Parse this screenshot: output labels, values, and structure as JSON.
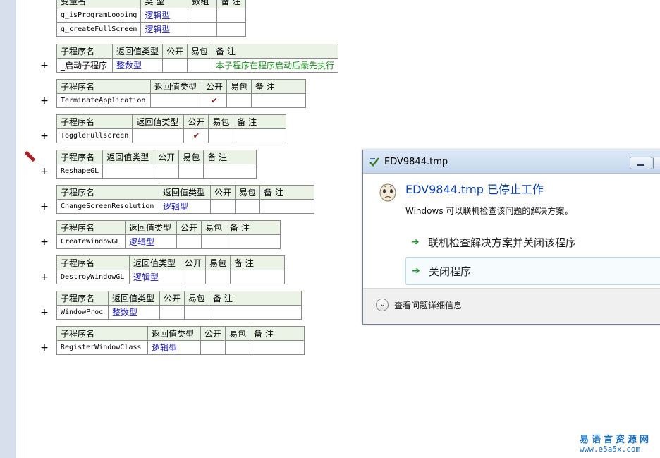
{
  "variables": {
    "headers": [
      "变量名",
      "类 型",
      "数组",
      "备 注"
    ],
    "rows": [
      {
        "name": "g_isProgramLooping",
        "type": "逻辑型"
      },
      {
        "name": "g_createFullScreen",
        "type": "逻辑型"
      }
    ]
  },
  "sub_headers": [
    "子程序名",
    "返回值类型",
    "公开",
    "易包",
    "备 注"
  ],
  "subroutines": [
    {
      "name": "_启动子程序",
      "return_type": "整数型",
      "public": "",
      "note": "本子程序在程序启动后最先执行"
    },
    {
      "name": "TerminateApplication",
      "return_type": "",
      "public": "✔",
      "note": ""
    },
    {
      "name": "ToggleFullscreen",
      "return_type": "",
      "public": "✔",
      "note": ""
    },
    {
      "name": "ReshapeGL",
      "return_type": "",
      "public": "",
      "note": ""
    },
    {
      "name": "ChangeScreenResolution",
      "return_type": "逻辑型",
      "public": "",
      "note": ""
    },
    {
      "name": "CreateWindowGL",
      "return_type": "逻辑型",
      "public": "",
      "note": ""
    },
    {
      "name": "DestroyWindowGL",
      "return_type": "逻辑型",
      "public": "",
      "note": ""
    },
    {
      "name": "WindowProc",
      "return_type": "整数型",
      "public": "",
      "note": ""
    },
    {
      "name": "RegisterWindowClass",
      "return_type": "逻辑型",
      "public": "",
      "note": ""
    }
  ],
  "expander_symbol": "+",
  "dialog": {
    "title": "EDV9844.tmp",
    "headline": "EDV9844.tmp 已停止工作",
    "message": "Windows 可以联机检查该问题的解决方案。",
    "option1": "联机检查解决方案并关闭该程序",
    "option2": "关闭程序",
    "details": "查看问题详细信息",
    "arrow_glyph": "➔"
  },
  "watermark": {
    "line1": "易语言资源网",
    "line2": "www.e5a5x.com"
  },
  "colors": {
    "keyword": "#1a1ab0",
    "comment": "#1a8a1a",
    "header_bg": "#ebf2e6",
    "dialog_headline": "#0a3fa8"
  }
}
